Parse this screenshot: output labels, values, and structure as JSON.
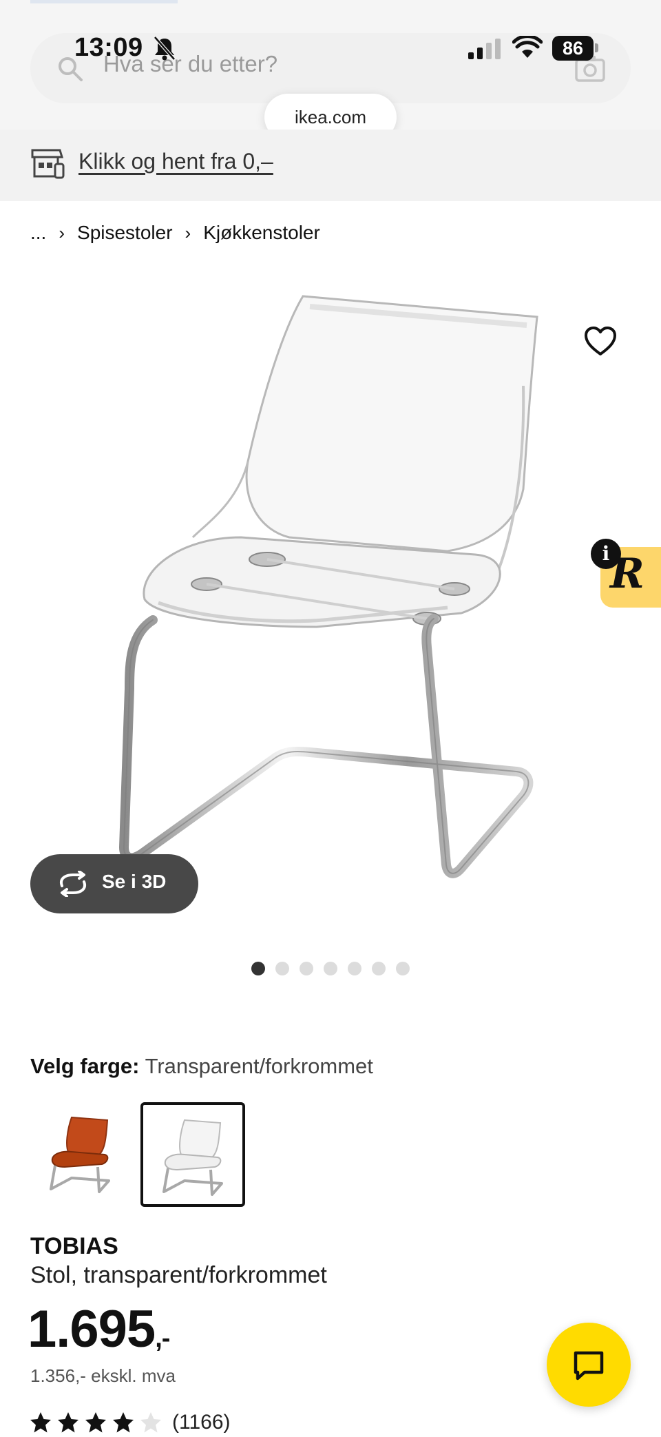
{
  "status_bar": {
    "time": "13:09",
    "battery": "86",
    "icons": [
      "bell-slash-icon",
      "signal-icon",
      "wifi-icon",
      "battery-icon"
    ]
  },
  "search": {
    "placeholder": "Hva ser du etter?",
    "icons": [
      "search-icon",
      "camera-icon"
    ]
  },
  "browser": {
    "url": "ikea.com"
  },
  "promo": {
    "click_collect": "Klikk og hent fra 0,–",
    "icon": "store-icon"
  },
  "breadcrumb": {
    "items": [
      "...",
      "Spisestoler",
      "Kjøkkenstoler"
    ]
  },
  "gallery": {
    "view_3d_label": "Se i 3D",
    "dots_total": 7,
    "active_dot": 1,
    "icons": [
      "heart-icon",
      "rotate-icon"
    ],
    "badge_letter": "R",
    "badge_info": "i"
  },
  "color_selector": {
    "label": "Velg farge:",
    "value": "Transparent/forkrommet",
    "swatches": [
      {
        "name": "orange",
        "color": "#c24a1a",
        "selected": false
      },
      {
        "name": "transparent",
        "color": "#e8e8e8",
        "selected": true
      }
    ]
  },
  "product": {
    "name": "TOBIAS",
    "description": "Stol, transparent/forkrommet",
    "price": "1.695",
    "price_suffix": ",-",
    "price_ex_vat": "1.356,- ekskl. mva",
    "rating": 4,
    "rating_max": 5,
    "review_count": "(1166)"
  },
  "colors": {
    "accent_yellow": "#ffdb00",
    "badge_yellow": "#fdd66b",
    "dark_button": "#484848"
  }
}
